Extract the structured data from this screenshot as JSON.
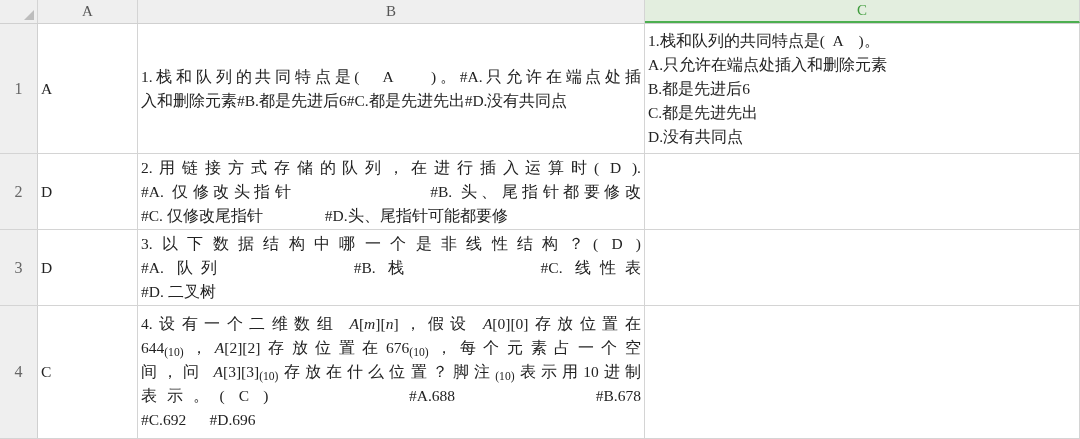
{
  "columns": [
    {
      "label": "A",
      "selected": false
    },
    {
      "label": "B",
      "selected": false
    },
    {
      "label": "C",
      "selected": true
    }
  ],
  "rows": [
    {
      "number": "1",
      "cells": [
        {
          "lines": [
            "A"
          ]
        },
        {
          "lines": [
            "1.栈和队列的共同特点是(   A     )。#A.只允许在端点处插",
            "入和删除元素#B.都是先进后6#C.都是先进先出#D.没有共同点"
          ]
        },
        {
          "lines": [
            "1.栈和队列的共同特点是(  A    )。",
            "A.只允许在端点处插入和删除元素",
            "B.都是先进后6",
            "C.都是先进先出",
            "D.没有共同点"
          ]
        }
      ]
    },
    {
      "number": "2",
      "cells": [
        {
          "lines": [
            "D"
          ]
        },
        {
          "lines": [
            "2.用链接方式存储的队列，在进行插入运算时( D ).",
            "#A. 仅修改头指针                #B. 头、尾指针都要修改",
            "#C. 仅修改尾指针                #D.头、尾指针可能都要修"
          ]
        },
        {}
      ]
    },
    {
      "number": "3",
      "cells": [
        {
          "lines": [
            "D"
          ]
        },
        {
          "lines": [
            "3.以下数据结构中哪一个是非线性结构？( D )",
            "#A. 队列          #B. 栈          #C. 线性表",
            "#D. 二叉树"
          ]
        },
        {}
      ]
    },
    {
      "number": "4",
      "cells": [
        {
          "lines": [
            "C"
          ]
        },
        {
          "lines": [
            "4.设有一个二维数组 *A*[*m*][*n*]，假设 *A*[0][0]存放位置在",
            "644$_{(10)}$，*A*[2][2]存放位置在676$_{(10)}$，每个元素占一个空",
            "间，问 *A*[3][3]$_{(10)}$存放在什么位置？脚注$_{(10)}$表示用10进制",
            "表示。( C )          #A.688          #B.678",
            "#C.692      #D.696"
          ]
        },
        {}
      ]
    }
  ]
}
